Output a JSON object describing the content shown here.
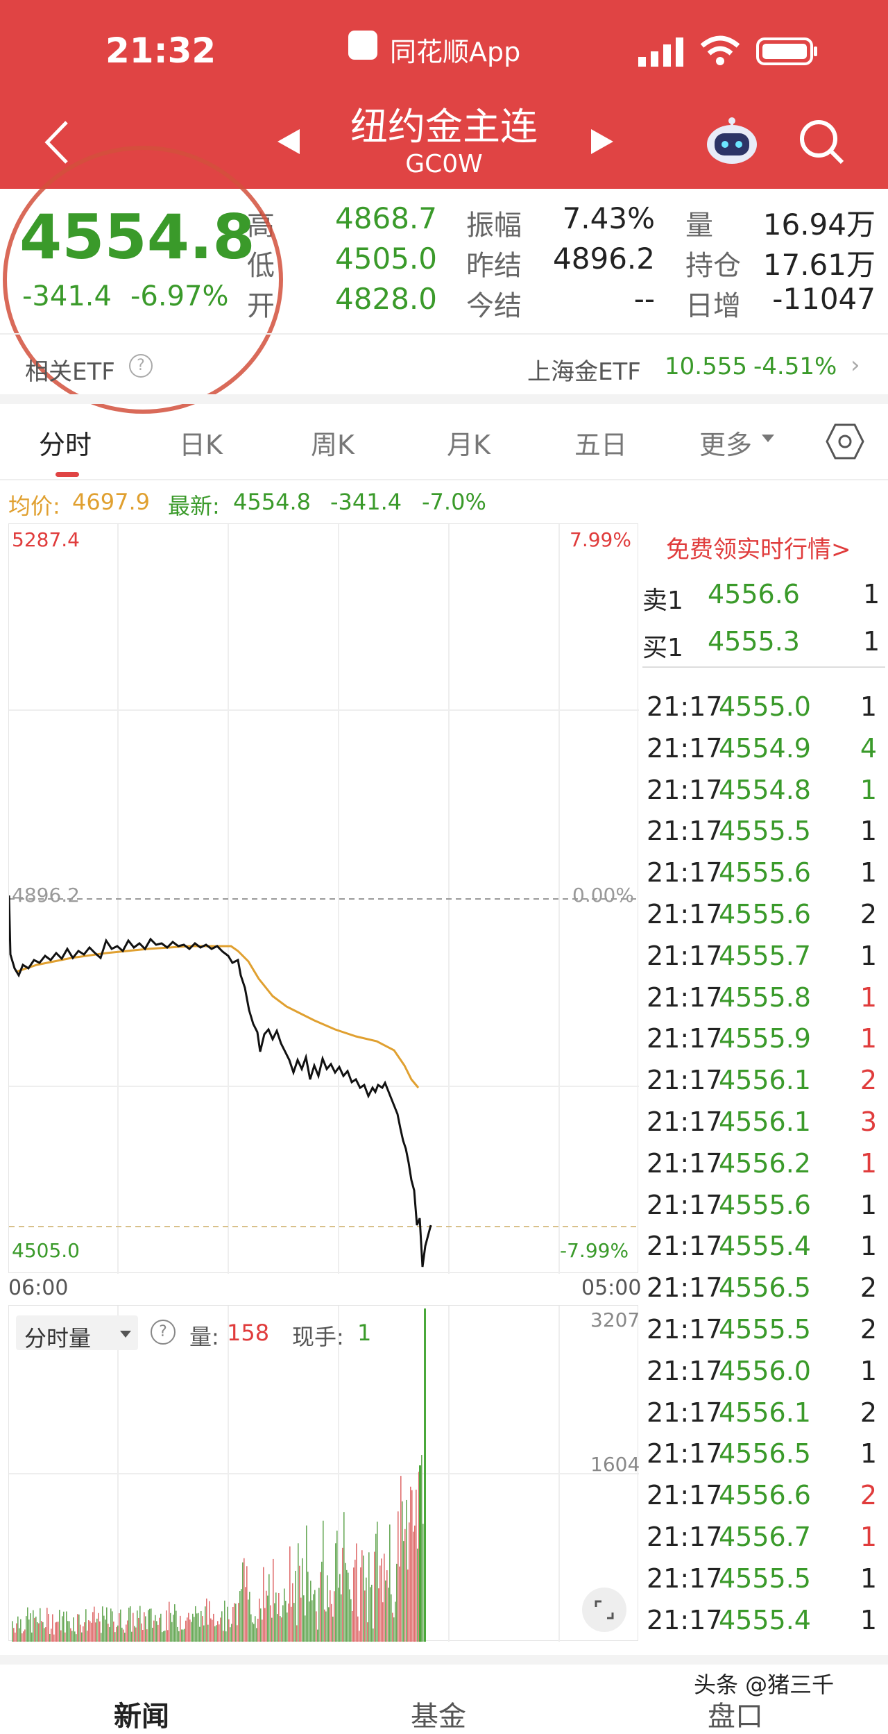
{
  "status_bar": {
    "time": "21:32",
    "app_name": "同花顺App"
  },
  "nav": {
    "title": "纽约金主连",
    "code": "GC0W"
  },
  "quote": {
    "price": "4554.8",
    "change": "-341.4",
    "change_pct": "-6.97%",
    "rows": [
      {
        "l1": "高",
        "v1": "4868.7",
        "l2": "振幅",
        "v2": "7.43%",
        "l3": "量",
        "v3": "16.94万"
      },
      {
        "l1": "低",
        "v1": "4505.0",
        "l2": "昨结",
        "v2": "4896.2",
        "l3": "持仓",
        "v3": "17.61万"
      },
      {
        "l1": "开",
        "v1": "4828.0",
        "l2": "今结",
        "v2": "--",
        "l3": "日增",
        "v3": "-11047"
      }
    ]
  },
  "etf": {
    "label": "相关ETF",
    "name": "上海金ETF",
    "price": "10.555",
    "change": "-4.51%"
  },
  "tabs": [
    "分时",
    "日K",
    "周K",
    "月K",
    "五日",
    "更多"
  ],
  "info_line": {
    "avg_label": "均价:",
    "avg_value": "4697.9",
    "latest_label": "最新:",
    "latest_value": "4554.8",
    "change": "-341.4",
    "change_pct": "-7.0%"
  },
  "chart_labels": {
    "top_left": "5287.4",
    "top_right": "7.99%",
    "mid_left": "4896.2",
    "mid_right": "0.00%",
    "bottom_left": "4505.0",
    "bottom_right": "-7.99%",
    "x_start": "06:00",
    "x_end": "05:00"
  },
  "volume_panel": {
    "selector": "分时量",
    "vol_label": "量:",
    "vol_value": "158",
    "hand_label": "现手:",
    "hand_value": "1",
    "max": "3207",
    "mid": "1604"
  },
  "order_book": {
    "promo": "免费领实时行情>",
    "sell": {
      "label": "卖1",
      "price": "4556.6",
      "qty": "1"
    },
    "buy": {
      "label": "买1",
      "price": "4555.3",
      "qty": "1"
    }
  },
  "trades": [
    {
      "time": "21:17",
      "price": "4555.0",
      "qty": "1",
      "c": "#222"
    },
    {
      "time": "21:17",
      "price": "4554.9",
      "qty": "4",
      "c": "#3a9a2a"
    },
    {
      "time": "21:17",
      "price": "4554.8",
      "qty": "1",
      "c": "#3a9a2a"
    },
    {
      "time": "21:17",
      "price": "4555.5",
      "qty": "1",
      "c": "#222"
    },
    {
      "time": "21:17",
      "price": "4555.6",
      "qty": "1",
      "c": "#222"
    },
    {
      "time": "21:17",
      "price": "4555.6",
      "qty": "2",
      "c": "#222"
    },
    {
      "time": "21:17",
      "price": "4555.7",
      "qty": "1",
      "c": "#222"
    },
    {
      "time": "21:17",
      "price": "4555.8",
      "qty": "1",
      "c": "#e03c3c"
    },
    {
      "time": "21:17",
      "price": "4555.9",
      "qty": "1",
      "c": "#e03c3c"
    },
    {
      "time": "21:17",
      "price": "4556.1",
      "qty": "2",
      "c": "#e03c3c"
    },
    {
      "time": "21:17",
      "price": "4556.1",
      "qty": "3",
      "c": "#e03c3c"
    },
    {
      "time": "21:17",
      "price": "4556.2",
      "qty": "1",
      "c": "#e03c3c"
    },
    {
      "time": "21:17",
      "price": "4555.6",
      "qty": "1",
      "c": "#222"
    },
    {
      "time": "21:17",
      "price": "4555.4",
      "qty": "1",
      "c": "#222"
    },
    {
      "time": "21:17",
      "price": "4556.5",
      "qty": "2",
      "c": "#222"
    },
    {
      "time": "21:17",
      "price": "4555.5",
      "qty": "2",
      "c": "#222"
    },
    {
      "time": "21:17",
      "price": "4556.0",
      "qty": "1",
      "c": "#222"
    },
    {
      "time": "21:17",
      "price": "4556.1",
      "qty": "2",
      "c": "#222"
    },
    {
      "time": "21:17",
      "price": "4556.5",
      "qty": "1",
      "c": "#222"
    },
    {
      "time": "21:17",
      "price": "4556.6",
      "qty": "2",
      "c": "#e03c3c"
    },
    {
      "time": "21:17",
      "price": "4556.7",
      "qty": "1",
      "c": "#e03c3c"
    },
    {
      "time": "21:17",
      "price": "4555.5",
      "qty": "1",
      "c": "#222"
    },
    {
      "time": "21:17",
      "price": "4555.4",
      "qty": "1",
      "c": "#222"
    }
  ],
  "bottom_tabs": [
    "新闻",
    "基金",
    "盘口"
  ],
  "watermark": "头条 @猪三千",
  "colors": {
    "header": "#e04444",
    "up": "#e03c3c",
    "down": "#3a9a2a",
    "avg_line": "#e0a030"
  }
}
